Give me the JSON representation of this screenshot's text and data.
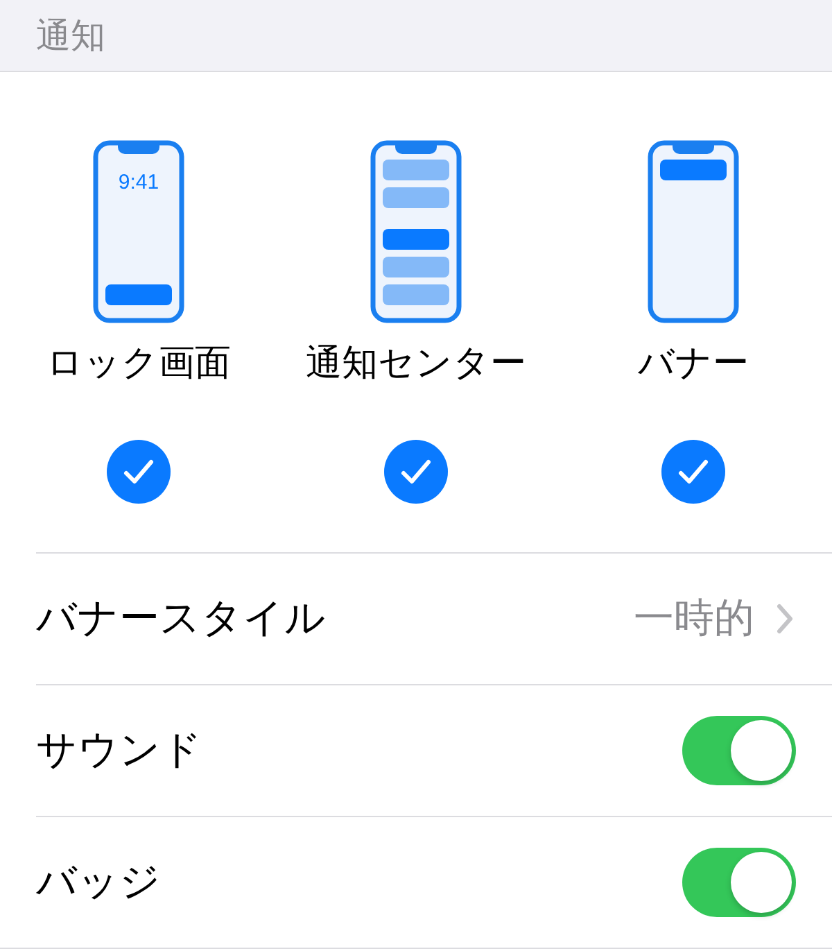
{
  "section_header": "通知",
  "alert_styles": [
    {
      "kind": "lock",
      "clock": "9:41",
      "label": "ロック画面",
      "selected": true
    },
    {
      "kind": "center",
      "label": "通知センター",
      "selected": true
    },
    {
      "kind": "banner",
      "label": "バナー",
      "selected": true
    }
  ],
  "rows": [
    {
      "kind": "disclosure",
      "label": "バナースタイル",
      "value": "一時的"
    },
    {
      "kind": "toggle",
      "label": "サウンド",
      "on": true
    },
    {
      "kind": "toggle",
      "label": "バッジ",
      "on": true
    }
  ]
}
